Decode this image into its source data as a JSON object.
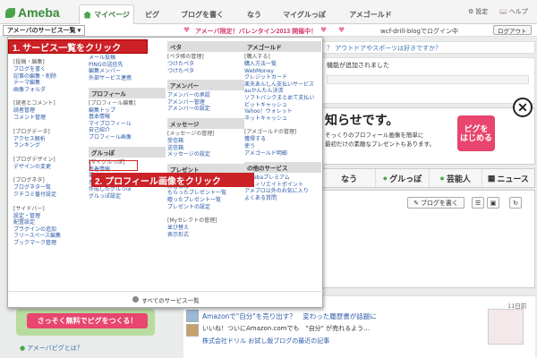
{
  "header": {
    "logo": "Ameba",
    "tabs": [
      "マイページ",
      "ピグ",
      "ブログを書く",
      "なう",
      "マイグルっぽ",
      "アメゴールド"
    ],
    "settings": "設定",
    "help": "ヘルプ"
  },
  "subbar": {
    "services_button": "アメーバのサービス一覧",
    "promo": "アメーバ限定！バレンタイン2013 開催中！",
    "login_status": "wcf-drill-blogでログイン中",
    "logout": "ログアウト"
  },
  "background": {
    "question": "？ アウトドアやスポーツは好きですか？",
    "notice": "機能が追加されました",
    "banner_title": "知らせです。",
    "banner_line1": "そっくりのプロフィール画像を簡単に",
    "banner_line2": "最初だけの素敵なプレゼントもあります。",
    "pig_button": "ピグを\nはじめる",
    "categories": [
      "なう",
      "グルっぽ",
      "芸能人",
      "ニュース"
    ],
    "write_blog": "ブログを書く",
    "free_button": "さっそく無料でピグをつくる！",
    "pig_link": "アメーバピグとは？",
    "news_date": "11日前",
    "news_title": "Amazonで\"自分\"を売り出す？　変わった履歴書が話題に",
    "news_line": "いいね！ついにAmazon.comでも　\"自分\" が売れるよう…",
    "news_link": "株式会社ドリル お試し版ブログの最近の記事"
  },
  "popup": {
    "columns": [
      {
        "groups": [
          {
            "sub": "[投稿・編集]",
            "links": [
              "ブログを書く",
              "記事の編集・削除",
              "テーマ編集",
              "画像フォルダ"
            ]
          },
          {
            "sub": "[読者とコメント]",
            "links": [
              "読者管理",
              "コメント管理"
            ]
          },
          {
            "sub": "[ブログデータ]",
            "links": [
              "アクセス解析",
              "ランキング"
            ]
          },
          {
            "sub": "[ブログデザイン]",
            "links": [
              "デザインの変更"
            ]
          },
          {
            "sub": "[ブログネタ]",
            "links": [
              "ブログネタ一覧",
              "クチコミ番付設定"
            ]
          },
          {
            "sub": "[サイドバー]",
            "links": [
              "設定・管理",
              "配置設定",
              "プラグインの追加",
              "フリースペース編集",
              "ブックマーク管理"
            ]
          }
        ]
      },
      {
        "groups": [
          {
            "sub": "",
            "links": [
              "メッセージボード",
              "ランキング・ジャンル",
              "メール投稿",
              "PINGの送信先",
              "編集メンバー",
              "外部サービス連携"
            ]
          }
        ],
        "sections": [
          {
            "head": "プロフィール",
            "sub": "[プロフィール編集]",
            "links": [
              "編集トップ",
              "基本情報",
              "マイプロフィール",
              "自己紹介",
              "プロフィール画像"
            ]
          },
          {
            "head": "グルっぽ",
            "sub": "[マイグルっぽ]",
            "links": [
              "新着情報",
              "掲示板の更新情報",
              "参加中のグルっぽ",
              "作成したグルっぽ",
              "グルっぽ設定"
            ]
          }
        ]
      },
      {
        "sections": [
          {
            "head": "ペタ",
            "sub": "[ペタ帳の管理]",
            "links": [
              "つけたペタ",
              "つけたペタ"
            ]
          },
          {
            "head": "アメンバー",
            "sub": "",
            "links": [
              "アメンバーの承認",
              "アメンバー管理",
              "アメンバーの設定"
            ]
          },
          {
            "head": "メッセージ",
            "sub": "[メッセージの管理]",
            "links": [
              "受信箱",
              "送信箱",
              "メッセージの設定"
            ]
          },
          {
            "head": "プレゼント",
            "sub": "[プレゼントの管理]",
            "links": [
              "新着情報",
              "もらったプレゼント一覧",
              "贈ったプレゼント一覧",
              "プレゼントの設定"
            ]
          },
          {
            "head": "",
            "sub": "[Myセレクトの管理]",
            "links": [
              "並び替え",
              "表示形式"
            ]
          }
        ]
      },
      {
        "sections": [
          {
            "head": "アメゴールド",
            "sub": "[購入する]",
            "links": [
              "購入方法一覧",
              "WebMoney",
              "クレジットカード",
              "楽天あんしん支払いサービス",
              "auかんたん決済",
              "ソフトバンクまとめて支払い",
              "ビットキャッシュ",
              "Yahoo！ウォレット",
              "ネットキャッシュ"
            ]
          },
          {
            "head": "",
            "sub": "[アメゴールドの管理]",
            "links": [
              "獲得する",
              "使う",
              "アメゴールド明細"
            ]
          },
          {
            "head": "の他のサービス",
            "sub": "",
            "links": [
              "Amebaプレミアム",
              "アフィリエイトポイント",
              "アメブロ以外のお気に入り",
              "よくある質問"
            ]
          }
        ]
      }
    ],
    "footer": "すべてのサービス一覧"
  },
  "callouts": {
    "step1": "1. サービス一覧をクリック",
    "step2": "2. プロフィール画像をクリック"
  }
}
